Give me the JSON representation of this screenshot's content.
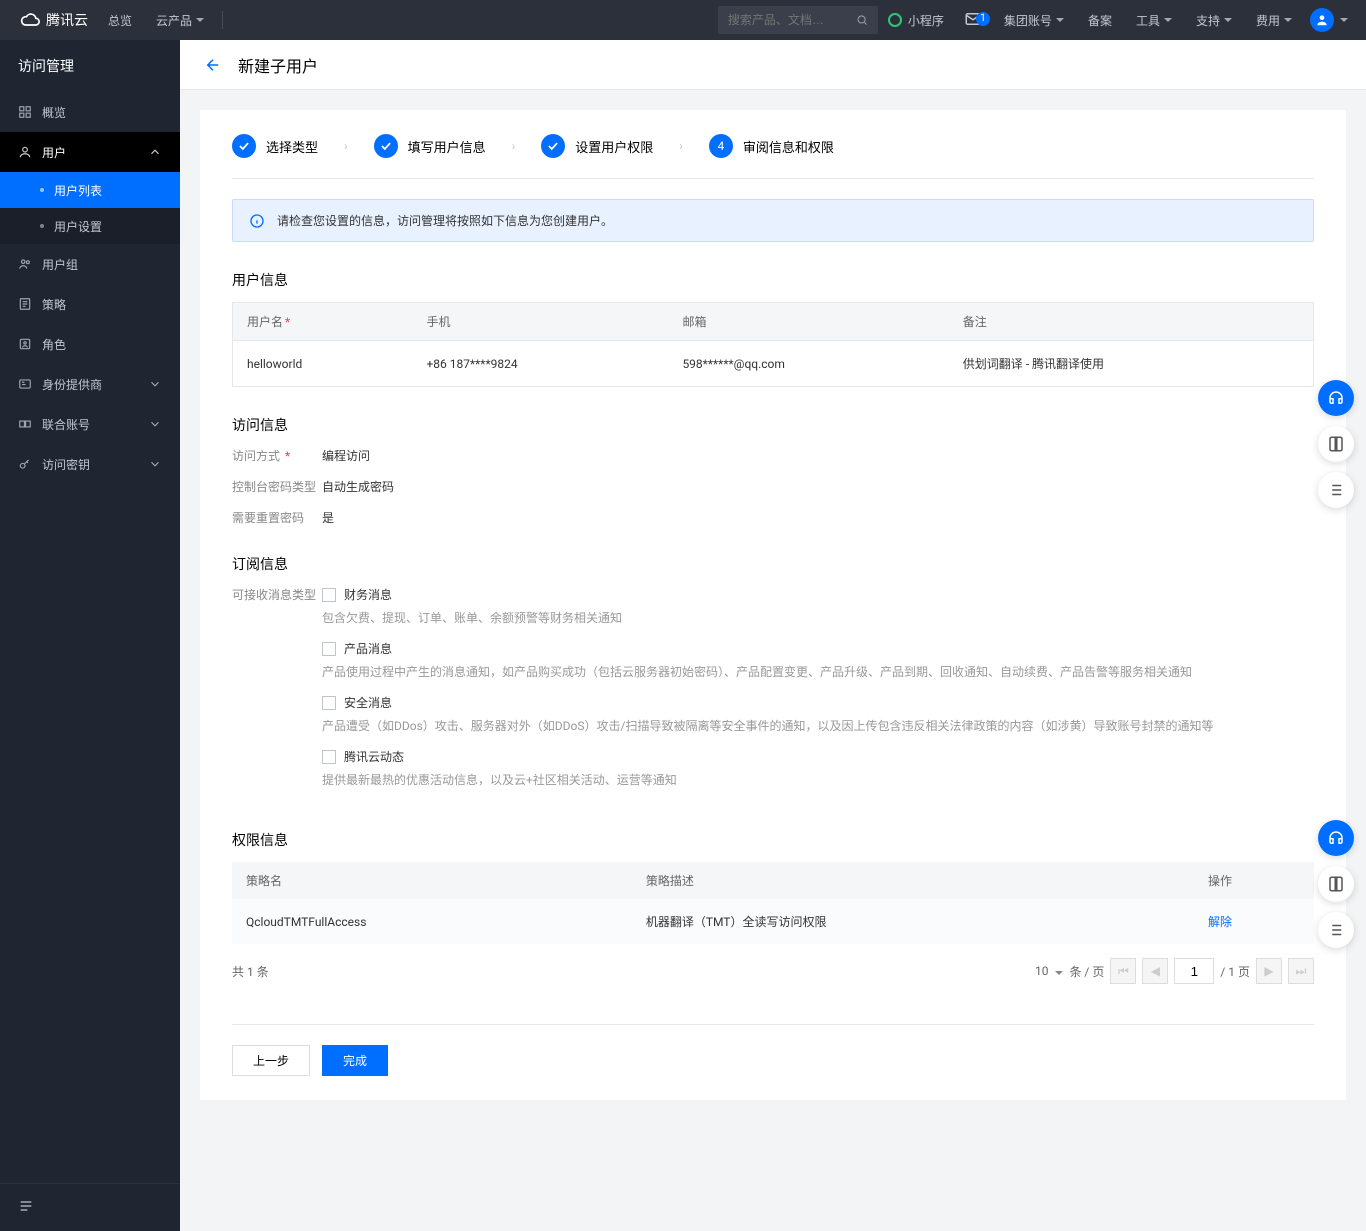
{
  "topnav": {
    "brand": "腾讯云",
    "overview": "总览",
    "products": "云产品",
    "search_placeholder": "搜索产品、文档…",
    "mini": "小程序",
    "mail_badge": "1",
    "group": "集团账号",
    "beian": "备案",
    "tools": "工具",
    "support": "支持",
    "cost": "费用"
  },
  "sidebar": {
    "app_title": "访问管理",
    "overview": "概览",
    "user": "用户",
    "user_list": "用户列表",
    "user_settings": "用户设置",
    "user_group": "用户组",
    "policy": "策略",
    "role": "角色",
    "idp": "身份提供商",
    "federation": "联合账号",
    "access_key": "访问密钥"
  },
  "page": {
    "title": "新建子用户"
  },
  "steps": {
    "s1": "选择类型",
    "s2": "填写用户信息",
    "s3": "设置用户权限",
    "s4": "审阅信息和权限",
    "current_num": "4"
  },
  "banner": "请检查您设置的信息，访问管理将按照如下信息为您创建用户。",
  "user_info": {
    "title": "用户信息",
    "col_user": "用户名",
    "col_phone": "手机",
    "col_email": "邮箱",
    "col_remark": "备注",
    "row": {
      "user": "helloworld",
      "phone": "+86 187****9824",
      "email": "598******@qq.com",
      "remark": "供划词翻译 - 腾讯翻译使用"
    }
  },
  "access": {
    "title": "访问信息",
    "method_k": "访问方式",
    "method_v": "编程访问",
    "pwdtype_k": "控制台密码类型",
    "pwdtype_v": "自动生成密码",
    "reset_k": "需要重置密码",
    "reset_v": "是"
  },
  "subscribe": {
    "title": "订阅信息",
    "types_k": "可接收消息类型",
    "finance_t": "财务消息",
    "finance_d": "包含欠费、提现、订单、账单、余额预警等财务相关通知",
    "product_t": "产品消息",
    "product_d": "产品使用过程中产生的消息通知，如产品购买成功（包括云服务器初始密码）、产品配置变更、产品升级、产品到期、回收通知、自动续费、产品告警等服务相关通知",
    "security_t": "安全消息",
    "security_d": "产品遭受（如DDos）攻击、服务器对外（如DDoS）攻击/扫描导致被隔离等安全事件的通知，以及因上传包含违反相关法律政策的内容（如涉黄）导致账号封禁的通知等",
    "news_t": "腾讯云动态",
    "news_d": "提供最新最热的优惠活动信息，以及云+社区相关活动、运营等通知"
  },
  "perm": {
    "title": "权限信息",
    "col_name": "策略名",
    "col_desc": "策略描述",
    "col_op": "操作",
    "row": {
      "name": "QcloudTMTFullAccess",
      "desc": "机器翻译（TMT）全读写访问权限",
      "unbind": "解除"
    }
  },
  "pagination": {
    "total": "共 1 条",
    "size": "10",
    "size_suffix": "条 / 页",
    "page": "1",
    "pages": "/ 1 页"
  },
  "footer": {
    "prev": "上一步",
    "done": "完成"
  }
}
